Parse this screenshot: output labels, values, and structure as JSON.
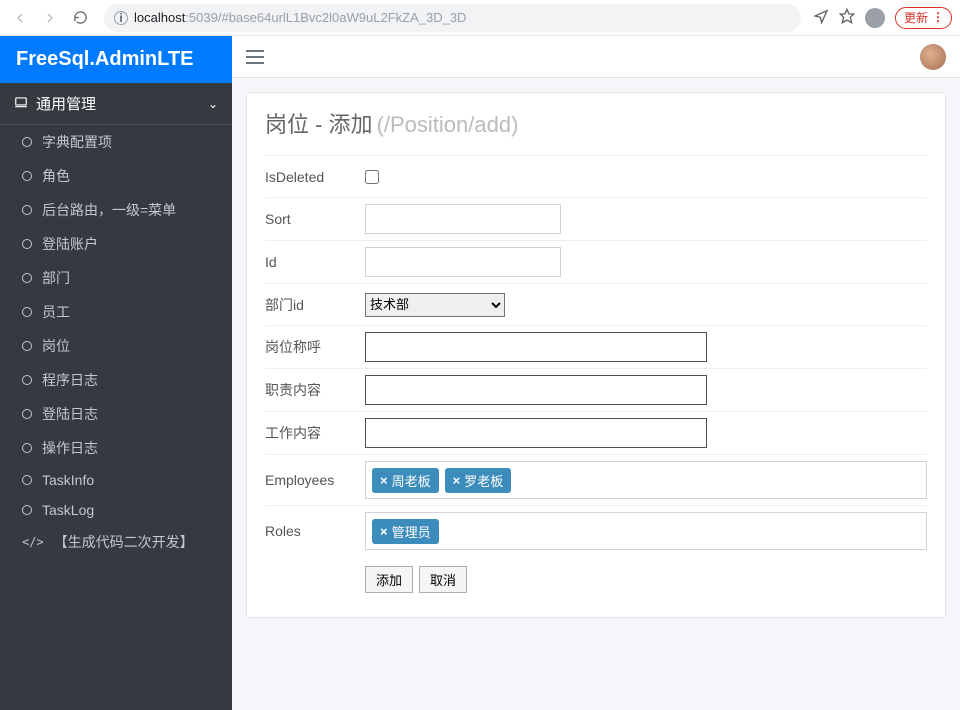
{
  "browser": {
    "url_host": "localhost",
    "url_port": ":5039",
    "url_path": "/#base64urlL1Bvc2l0aW9uL2FkZA_3D_3D",
    "update_label": "更新"
  },
  "header": {
    "brand": "FreeSql.AdminLTE"
  },
  "sidebar": {
    "section": "通用管理",
    "items": [
      "字典配置项",
      "角色",
      "后台路由，一级=菜单",
      "登陆账户",
      "部门",
      "员工",
      "岗位",
      "程序日志",
      "登陆日志",
      "操作日志",
      "TaskInfo",
      "TaskLog"
    ],
    "dev_item": "【生成代码二次开发】"
  },
  "page": {
    "title_main": "岗位 - 添加 ",
    "title_muted": "(/Position/add)"
  },
  "form": {
    "labels": {
      "isDeleted": "IsDeleted",
      "sort": "Sort",
      "id": "Id",
      "deptId": "部门id",
      "positionName": "岗位称呼",
      "duty": "职责内容",
      "work": "工作内容",
      "employees": "Employees",
      "roles": "Roles"
    },
    "values": {
      "isDeleted": false,
      "sort": "",
      "id": "",
      "deptId_selected": "技术部",
      "positionName": "",
      "duty": "",
      "work": ""
    },
    "employees": [
      "周老板",
      "罗老板"
    ],
    "roles": [
      "管理员"
    ],
    "buttons": {
      "submit": "添加",
      "cancel": "取消"
    }
  }
}
